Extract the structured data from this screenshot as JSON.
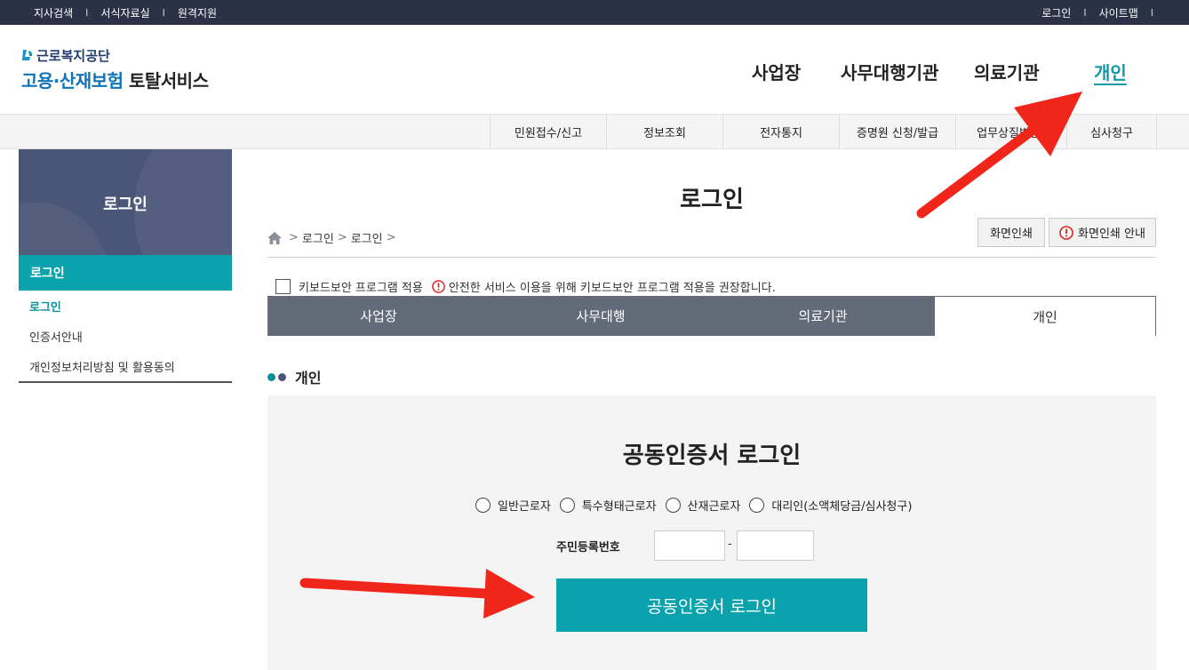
{
  "topbar": {
    "left_links": [
      "지사검색",
      "서식자료실",
      "원격지원"
    ],
    "right_links": [
      "로그인",
      "사이트맵"
    ],
    "separator": "I"
  },
  "logo": {
    "org": "근로복지공단",
    "service_a": "고용·산재보험",
    "service_b": "토탈서비스"
  },
  "gnb": [
    "사업장",
    "사무대행기관",
    "의료기관",
    "개인"
  ],
  "submenu": [
    "민원접수/신고",
    "정보조회",
    "전자통지",
    "증명원 신청/발급",
    "업무상질병판정",
    "심사청구"
  ],
  "lnb": {
    "title": "로그인",
    "active": "로그인",
    "items": [
      "로그인",
      "인증서안내",
      "개인정보처리방침 및 활용동의"
    ]
  },
  "main": {
    "title": "로그인",
    "breadcrumb": [
      "로그인",
      "로그인"
    ],
    "print_button": "화면인쇄",
    "print_guide_button": "화면인쇄 안내",
    "keyboard_label": "키보드보안 프로그램 적용",
    "keyboard_notice": "안전한 서비스 이용을 위해 키보드보안 프로그램 적용을 권장합니다.",
    "tabs": [
      "사업장",
      "사무대행",
      "의료기관",
      "개인"
    ],
    "section_title": "개인",
    "login_box": {
      "heading": "공동인증서 로그인",
      "options": [
        "일반근로자",
        "특수형태근로자",
        "산재근로자",
        "대리인(소액체당금/심사청구)"
      ],
      "id_label": "주민등록번호",
      "id_part1": "",
      "id_part2": "",
      "id_separator": "-",
      "button": "공동인증서 로그인"
    }
  },
  "colors": {
    "accent": "#0aa3ad",
    "topbar": "#2b3146",
    "tab_dark": "#646b78",
    "arrow": "#f0261b"
  },
  "icons": {
    "home": "home-icon",
    "warning": "warning-circle-icon",
    "arrow": "red-pointer-arrow"
  }
}
